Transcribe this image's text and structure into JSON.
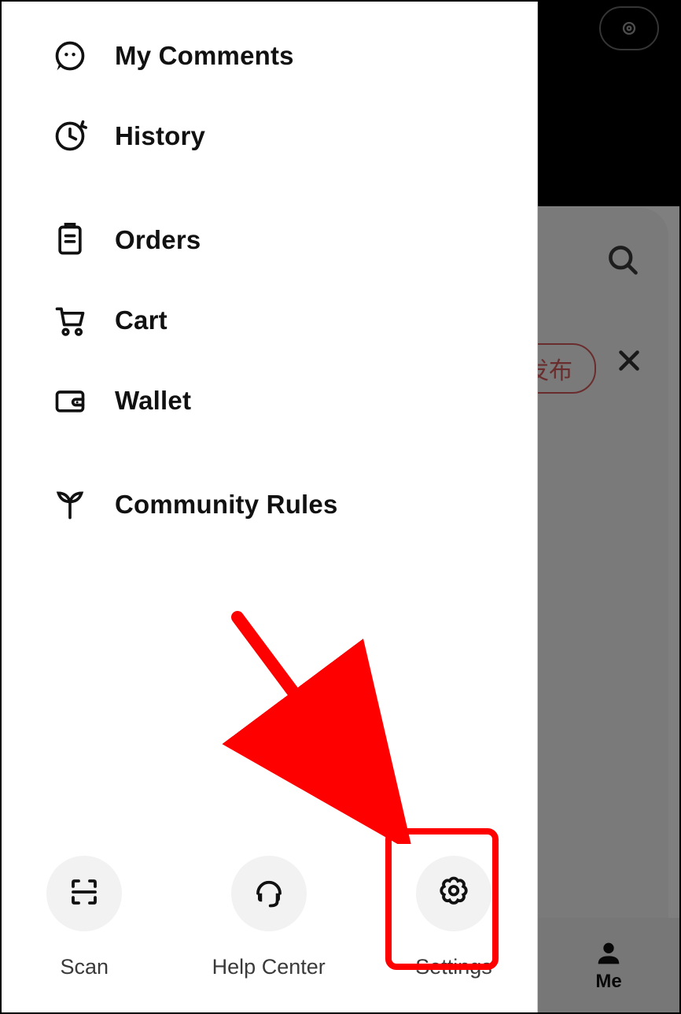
{
  "drawer": {
    "menu": [
      {
        "label": "My Comments",
        "icon": "comment-icon"
      },
      {
        "label": "History",
        "icon": "history-icon"
      },
      {
        "label": "Orders",
        "icon": "orders-icon"
      },
      {
        "label": "Cart",
        "icon": "cart-icon"
      },
      {
        "label": "Wallet",
        "icon": "wallet-icon"
      },
      {
        "label": "Community Rules",
        "icon": "sprout-icon"
      }
    ],
    "bottom": [
      {
        "label": "Scan",
        "icon": "scan-icon"
      },
      {
        "label": "Help Center",
        "icon": "headset-icon"
      },
      {
        "label": "Settings",
        "icon": "settings-icon"
      }
    ]
  },
  "background": {
    "pill_label": "发布",
    "nav_label": "Me"
  },
  "annotation": {
    "highlight_target": "settings-button",
    "arrow_color": "#ff0000"
  }
}
